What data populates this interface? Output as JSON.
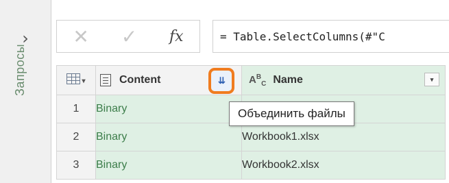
{
  "left_panel": {
    "expand_symbol": "›",
    "label": "Запросы"
  },
  "formula_bar": {
    "cancel_symbol": "✕",
    "confirm_symbol": "✓",
    "fx_symbol": "fx",
    "formula": "= Table.SelectColumns(#\"C"
  },
  "grid": {
    "columns": [
      {
        "label": "Content",
        "icon": "document-icon",
        "action_icon": "combine-files-icon",
        "action_text": "⇊"
      },
      {
        "label": "Name",
        "icon": "abc-text-type-icon",
        "filter_symbol": "▾"
      }
    ],
    "rows": [
      {
        "num": "1",
        "content": "Binary",
        "name": ""
      },
      {
        "num": "2",
        "content": "Binary",
        "name": "Workbook1.xlsx"
      },
      {
        "num": "3",
        "content": "Binary",
        "name": "Workbook2.xlsx"
      }
    ]
  },
  "tooltip": {
    "text": "Объединить файлы"
  },
  "colors": {
    "highlight": "#f07c1f",
    "selected_column": "#dff0e4",
    "binary_text": "#3c7d4a"
  }
}
